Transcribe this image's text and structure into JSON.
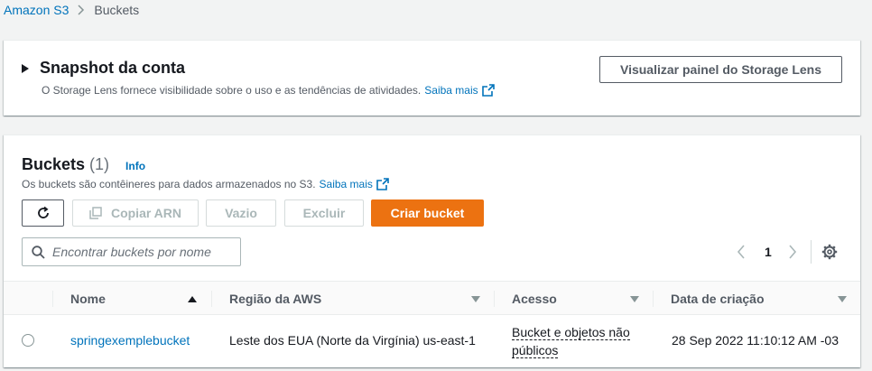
{
  "breadcrumb": {
    "root": "Amazon S3",
    "current": "Buckets"
  },
  "snapshot": {
    "title": "Snapshot da conta",
    "description": "O Storage Lens fornece visibilidade sobre o uso e as tendências de atividades.",
    "learn_more": "Saiba mais",
    "lens_button": "Visualizar painel do Storage Lens"
  },
  "buckets": {
    "title": "Buckets",
    "count": "(1)",
    "info": "Info",
    "description": "Os buckets são contêineres para dados armazenados no S3.",
    "learn_more": "Saiba mais",
    "actions": {
      "copy_arn": "Copiar ARN",
      "empty": "Vazio",
      "delete": "Excluir",
      "create": "Criar bucket"
    },
    "search_placeholder": "Encontrar buckets por nome",
    "page": "1",
    "columns": {
      "name": "Nome",
      "region": "Região da AWS",
      "access": "Acesso",
      "created": "Data de criação"
    },
    "rows": [
      {
        "name": "springexemplebucket",
        "region": "Leste dos EUA (Norte da Virgínia) us-east-1",
        "access": "Bucket e objetos não públicos",
        "created": "28 Sep 2022 11:10:12 AM -03"
      }
    ]
  },
  "colors": {
    "link": "#0073bb",
    "primary": "#ec7211",
    "text": "#16191f",
    "muted": "#545b64"
  }
}
